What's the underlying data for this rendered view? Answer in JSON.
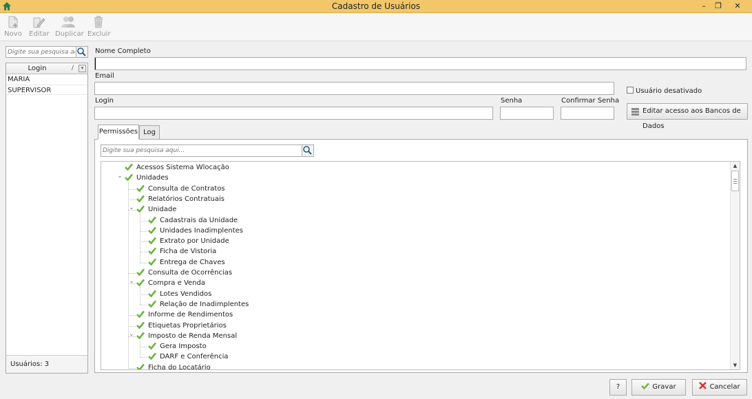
{
  "window": {
    "title": "Cadastro de Usuários",
    "minimize": "–",
    "restore": "❐",
    "close": "✕"
  },
  "toolbar": {
    "novo": "Novo",
    "editar": "Editar",
    "duplicar": "Duplicar",
    "excluir": "Excluir"
  },
  "left": {
    "search_placeholder": "Digite sua pesquisa aqui...",
    "column_header": "Login",
    "sort_mark": "/",
    "users": [
      "MARIA",
      "SUPERVISOR"
    ],
    "footer": "Usuários: 3"
  },
  "form": {
    "nome_label": "Nome Completo",
    "nome_value": "",
    "email_label": "Email",
    "email_value": "",
    "login_label": "Login",
    "login_value": "",
    "senha_label": "Senha",
    "senha_value": "",
    "confirmar_label": "Confirmar Senha",
    "confirmar_value": "",
    "desativado_label": "Usuário desativado",
    "desativado_checked": false,
    "db_button": "Editar acesso aos Bancos de Dados"
  },
  "tabs": {
    "permissoes": "Permissões",
    "log": "Log"
  },
  "tree": {
    "search_placeholder": "Digite sua pesquisa aqui...",
    "items": [
      {
        "label": "Acessos Sistema Wlocação",
        "level": 0,
        "expandable": false
      },
      {
        "label": "Unidades",
        "level": 0,
        "expandable": true
      },
      {
        "label": "Consulta de Contratos",
        "level": 1,
        "expandable": false
      },
      {
        "label": "Relatórios Contratuais",
        "level": 1,
        "expandable": false
      },
      {
        "label": "Unidade",
        "level": 1,
        "expandable": true
      },
      {
        "label": "Cadastrais da Unidade",
        "level": 2,
        "expandable": false
      },
      {
        "label": "Unidades Inadimplentes",
        "level": 2,
        "expandable": false
      },
      {
        "label": "Extrato por Unidade",
        "level": 2,
        "expandable": false
      },
      {
        "label": "Ficha de Vistoria",
        "level": 2,
        "expandable": false
      },
      {
        "label": "Entrega de Chaves",
        "level": 2,
        "expandable": false
      },
      {
        "label": "Consulta de Ocorrências",
        "level": 1,
        "expandable": false
      },
      {
        "label": "Compra e Venda",
        "level": 1,
        "expandable": true
      },
      {
        "label": "Lotes Vendidos",
        "level": 2,
        "expandable": false
      },
      {
        "label": "Relação de Inadimplentes",
        "level": 2,
        "expandable": false
      },
      {
        "label": "Informe de Rendimentos",
        "level": 1,
        "expandable": false
      },
      {
        "label": "Etiquetas Proprietários",
        "level": 1,
        "expandable": false
      },
      {
        "label": "Imposto de Renda Mensal",
        "level": 1,
        "expandable": true
      },
      {
        "label": "Gera Imposto",
        "level": 2,
        "expandable": false
      },
      {
        "label": "DARF e Conferência",
        "level": 2,
        "expandable": false
      },
      {
        "label": "Ficha do Locatário",
        "level": 1,
        "expandable": false
      }
    ]
  },
  "buttons": {
    "help": "?",
    "gravar": "Gravar",
    "cancelar": "Cancelar"
  },
  "colors": {
    "titlebar": "#f1c76a",
    "check_green": "#6cb33f",
    "cancel_red": "#d9302c"
  }
}
